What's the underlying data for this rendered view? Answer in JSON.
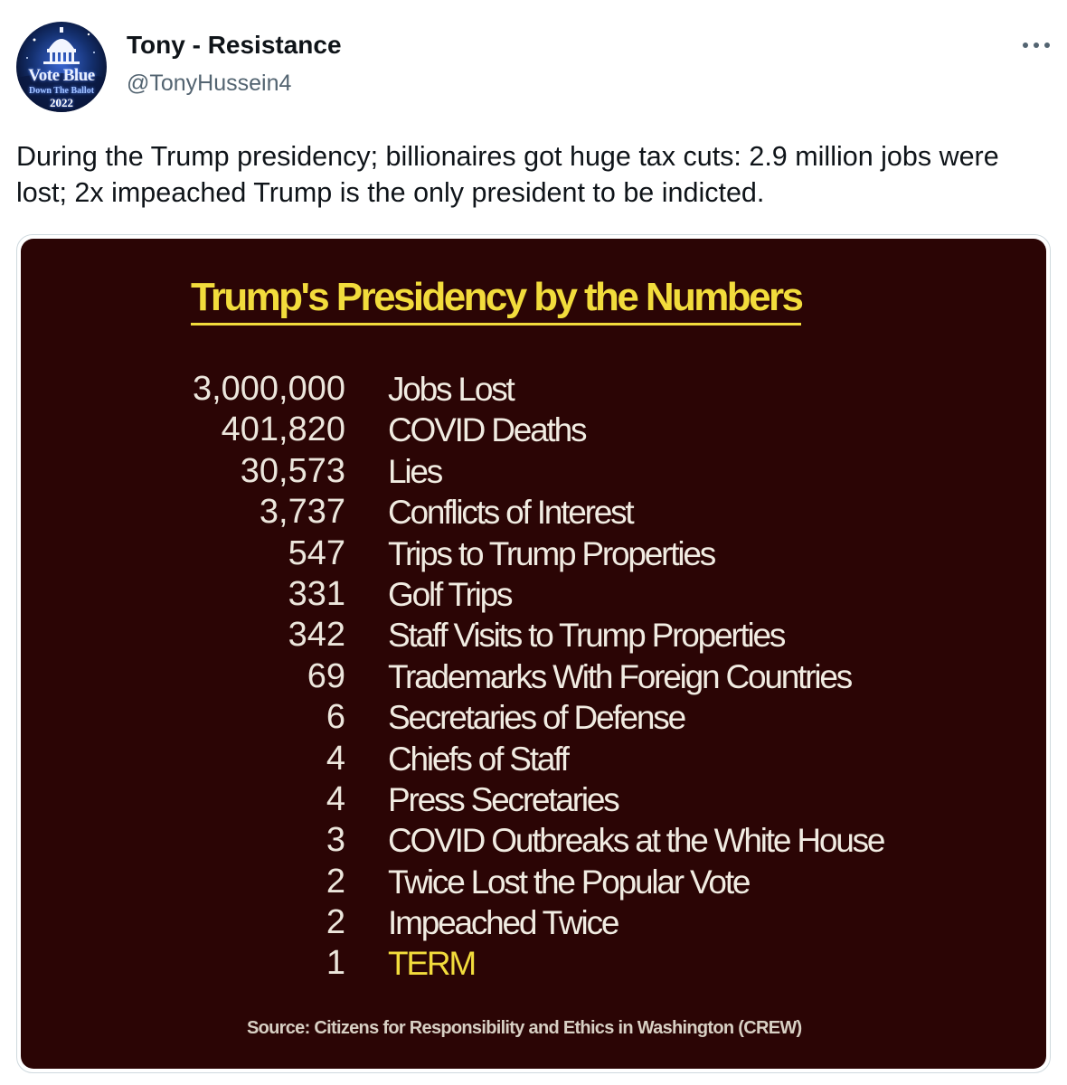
{
  "tweet": {
    "author": {
      "name": "Tony - Resistance",
      "handle": "@TonyHussein4",
      "avatar_text": {
        "line1": "Vote Blue",
        "line2": "Down The Ballot",
        "line3": "2022"
      }
    },
    "more_icon": "more-horizontal-icon",
    "text": "During the Trump presidency; billionaires got huge tax cuts: 2.9 million jobs were lost; 2x impeached Trump is the only president to be indicted."
  },
  "media": {
    "title": "Trump's Presidency by the Numbers",
    "rows": [
      {
        "value": "3,000,000",
        "label": "Jobs Lost"
      },
      {
        "value": "401,820",
        "label": "COVID Deaths"
      },
      {
        "value": "30,573",
        "label": "Lies"
      },
      {
        "value": "3,737",
        "label": "Conflicts of Interest"
      },
      {
        "value": "547",
        "label": "Trips to Trump Properties"
      },
      {
        "value": "331",
        "label": "Golf Trips"
      },
      {
        "value": "342",
        "label": "Staff Visits to Trump Properties"
      },
      {
        "value": "69",
        "label": "Trademarks With Foreign Countries"
      },
      {
        "value": "6",
        "label": "Secretaries of Defense"
      },
      {
        "value": "4",
        "label": "Chiefs of Staff"
      },
      {
        "value": "4",
        "label": "Press Secretaries"
      },
      {
        "value": "3",
        "label": "COVID Outbreaks at the White House"
      },
      {
        "value": "2",
        "label": "Twice Lost the Popular Vote"
      },
      {
        "value": "2",
        "label": "Impeached Twice"
      },
      {
        "value": "1",
        "label": "TERM",
        "highlight": true
      }
    ],
    "source": "Source: Citizens for Responsibility and Ethics in Washington (CREW)"
  },
  "colors": {
    "background": "#ffffff",
    "text": "#0f1419",
    "secondary_text": "#536471",
    "media_border": "#cfd9de",
    "infographic_bg": "#2b0505",
    "infographic_title": "#f2dc3c",
    "infographic_text": "#f1ece2"
  }
}
